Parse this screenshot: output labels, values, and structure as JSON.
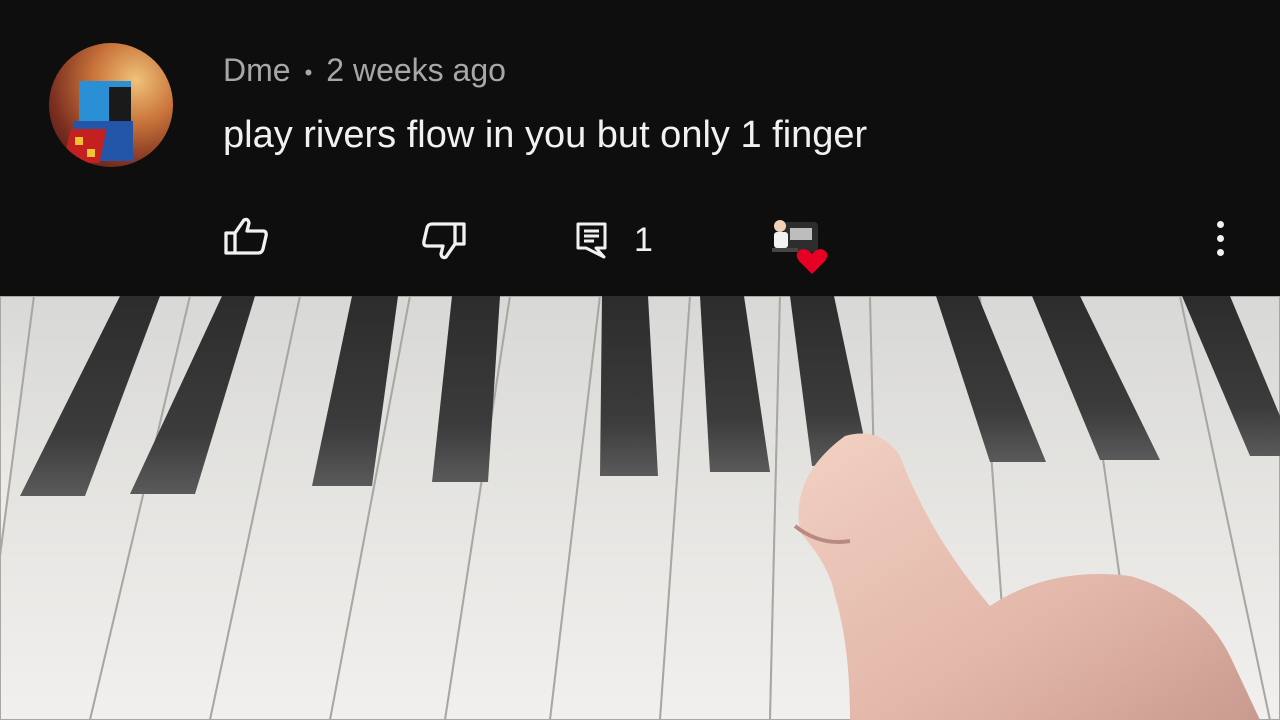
{
  "comment": {
    "author": "Dme",
    "separator": "•",
    "time_ago": "2 weeks ago",
    "text": "play rivers flow in you but only 1 finger",
    "reply_count": "1"
  },
  "icons": {
    "like": "thumbs-up-icon",
    "dislike": "thumbs-down-icon",
    "reply": "reply-comment-icon",
    "creator_heart": "creator-heart-icon",
    "more": "more-vertical-icon"
  },
  "colors": {
    "background": "#0e0e0f",
    "author_text": "#a7a7a7",
    "comment_text": "#f1f1f1",
    "heart": "#e60023"
  }
}
